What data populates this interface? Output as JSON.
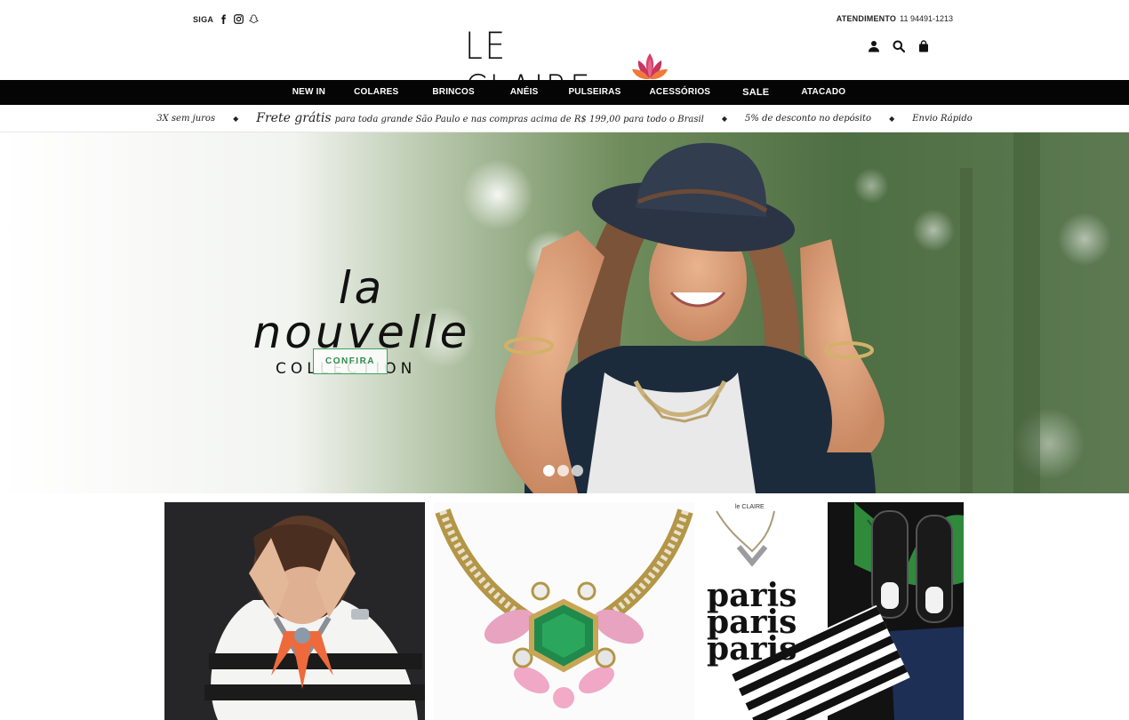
{
  "header": {
    "follow_label": "SIGA",
    "social_icons": [
      "facebook-icon",
      "instagram-icon",
      "snapchat-icon"
    ],
    "logo_text": "LE CLAIRE",
    "support_label": "ATENDIMENTO",
    "support_phone": "11 94491-1213",
    "user_icons": [
      "user-icon",
      "search-icon",
      "shopping-bag-icon"
    ]
  },
  "nav": {
    "items": [
      "NEW IN",
      "COLARES",
      "BRINCOS",
      "ANÉIS",
      "PULSEIRAS",
      "ACESSÓRIOS",
      "SALE",
      "ATACADO"
    ]
  },
  "promo": {
    "installments": "3X sem juros",
    "shipping_big": "Frete grátis",
    "shipping_small": "para toda grande São Paulo e nas compras acima de R$ 199,00 para todo o Brasil",
    "discount": "5% de desconto no depósito",
    "delivery": "Envio Rápido"
  },
  "hero": {
    "script_title": "la nouvelle",
    "subtitle": "COLLECTION",
    "cta_label": "CONFIRA",
    "slides": 3,
    "active_slide": 1
  },
  "products": {
    "shirt_brand": "le CLAIRE",
    "shirt_text": "paris paris paris"
  },
  "colors": {
    "nav_bg": "#050505",
    "cta_green": "#3aa55a",
    "lotus_pink": "#d9426e",
    "lotus_orange": "#f07a3a"
  }
}
